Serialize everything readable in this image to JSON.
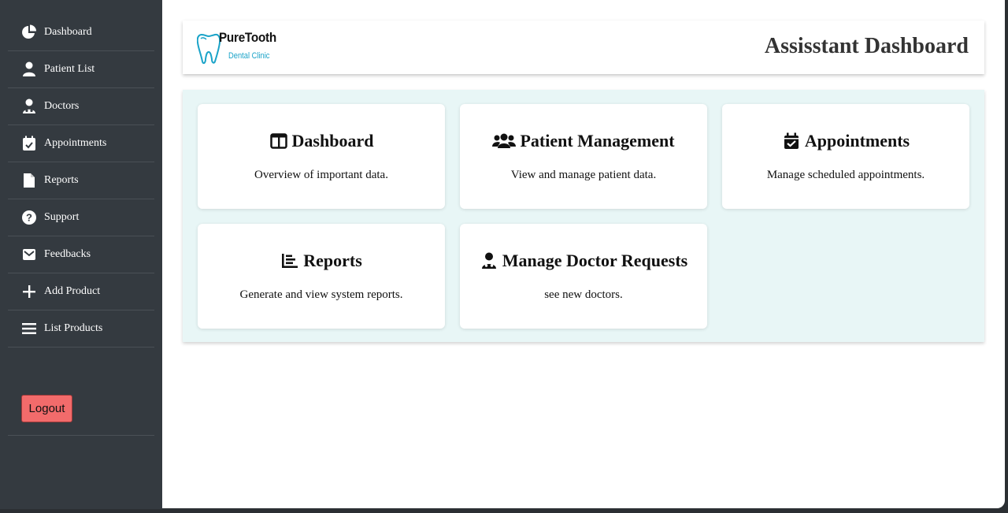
{
  "sidebar": {
    "items": [
      {
        "label": "Dashboard",
        "icon": "pie-chart-icon"
      },
      {
        "label": "Patient List",
        "icon": "user-icon"
      },
      {
        "label": "Doctors",
        "icon": "doctor-icon"
      },
      {
        "label": "Appointments",
        "icon": "calendar-check-icon"
      },
      {
        "label": "Reports",
        "icon": "file-icon"
      },
      {
        "label": "Support",
        "icon": "question-circle-icon"
      },
      {
        "label": "Feedbacks",
        "icon": "envelope-icon"
      },
      {
        "label": "Add Product",
        "icon": "plus-icon"
      },
      {
        "label": "List Products",
        "icon": "bars-icon"
      }
    ],
    "logout_label": "Logout"
  },
  "header": {
    "logo_name": "PureTooth",
    "logo_sub": "Dental Clinic",
    "title": "Assisstant Dashboard"
  },
  "cards": [
    {
      "title": "Dashboard",
      "desc": "Overview of important data.",
      "icon": "columns-icon"
    },
    {
      "title": "Patient Management",
      "desc": "View and manage patient data.",
      "icon": "users-icon"
    },
    {
      "title": "Appointments",
      "desc": "Manage scheduled appointments.",
      "icon": "calendar-check-icon"
    },
    {
      "title": "Reports",
      "desc": "Generate and view system reports.",
      "icon": "chart-list-icon"
    },
    {
      "title": "Manage Doctor Requests",
      "desc": "see new doctors.",
      "icon": "doctor-icon"
    }
  ],
  "colors": {
    "sidebar_bg": "#343a40",
    "panel_bg": "#e8f6f6",
    "logout_bg": "#f26b6b",
    "logo_accent": "#1aa3c8"
  }
}
